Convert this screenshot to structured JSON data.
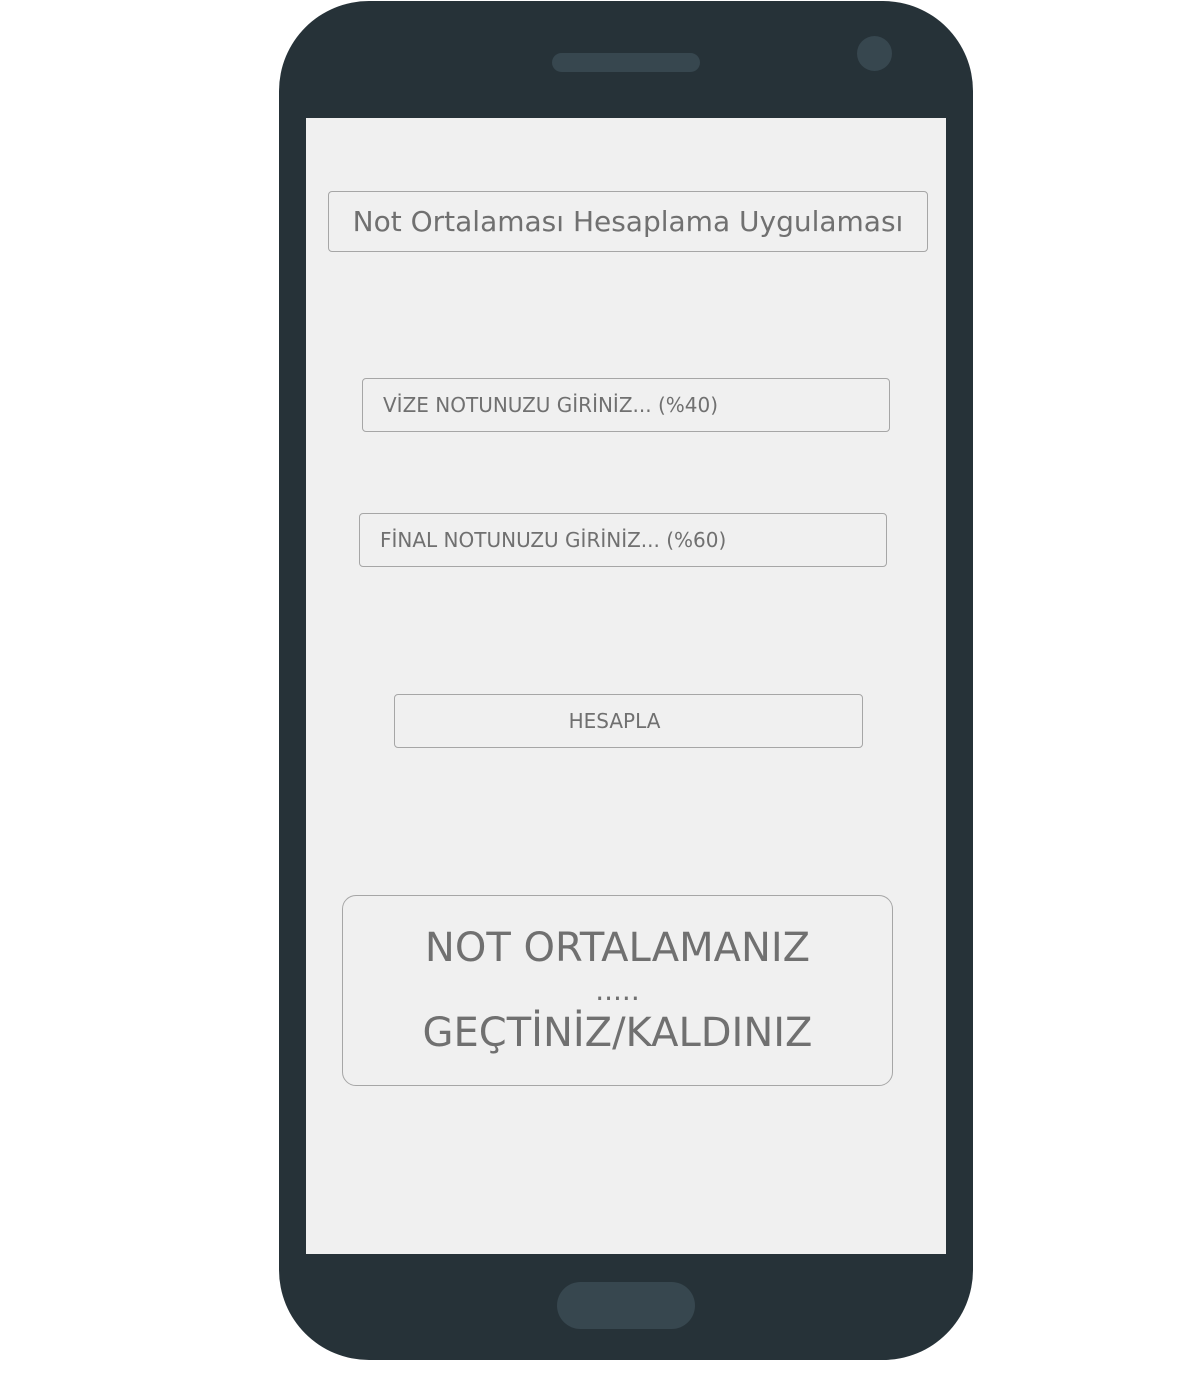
{
  "app": {
    "title": "Not Ortalaması Hesaplama Uygulaması"
  },
  "form": {
    "midterm_placeholder": "VİZE NOTUNUZU GİRİNİZ... (%40)",
    "final_placeholder": "FİNAL NOTUNUZU GİRİNİZ... (%60)",
    "calculate_label": "HESAPLA"
  },
  "result": {
    "heading": "NOT ORTALAMANIZ",
    "value": ".....",
    "status": "GEÇTİNİZ/KALDINIZ"
  },
  "colors": {
    "device_body": "#263238",
    "device_accent": "#37474f",
    "screen_background": "#f0f0f0",
    "text": "#707070",
    "border": "#a6a6a6"
  }
}
